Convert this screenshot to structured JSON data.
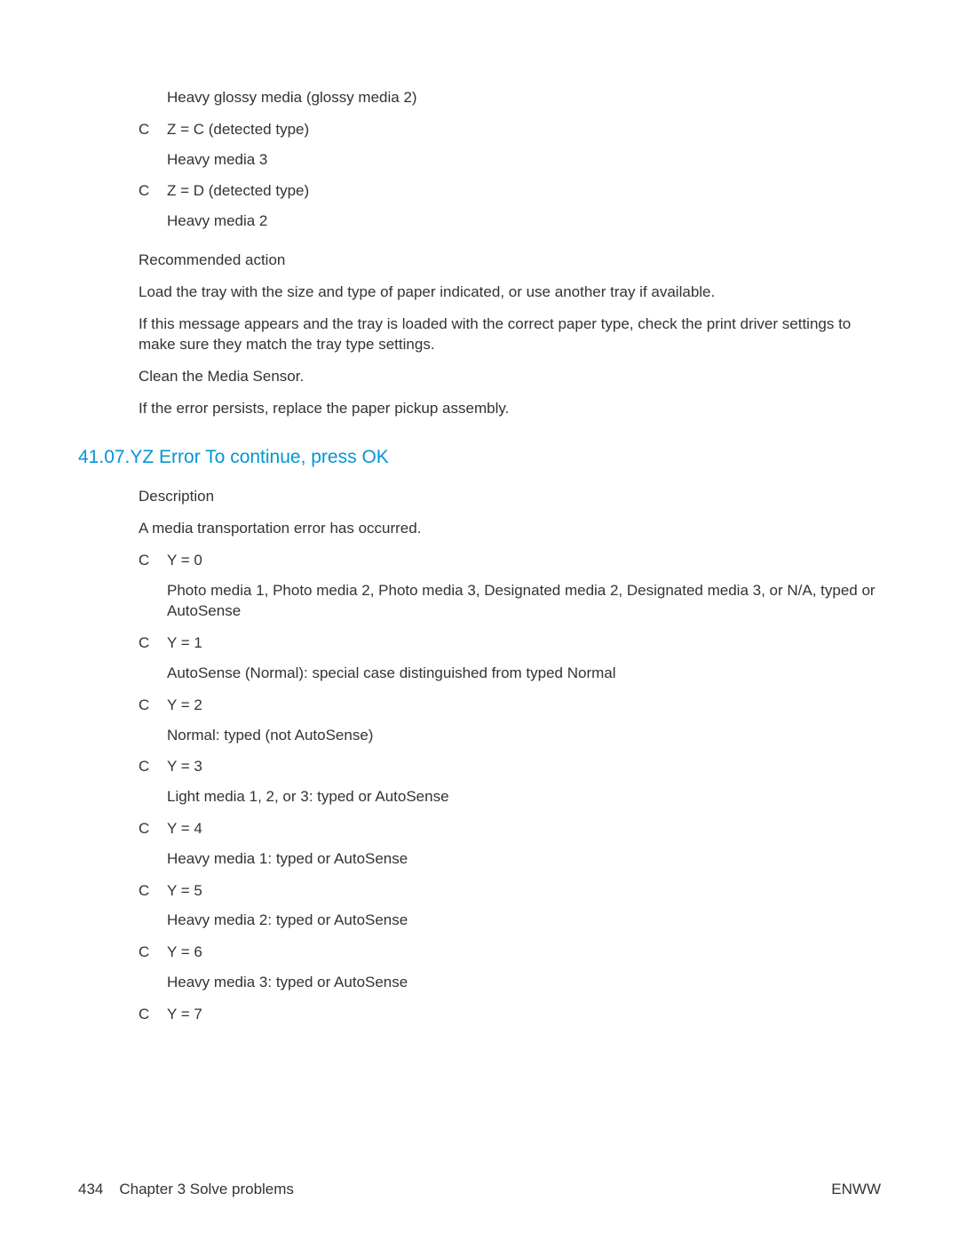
{
  "section1": {
    "leading_nested": "Heavy glossy media (glossy media 2)",
    "items": [
      {
        "code": "Z = C (detected type)",
        "detail": "Heavy media 3"
      },
      {
        "code": "Z = D (detected type)",
        "detail": "Heavy media 2"
      }
    ],
    "recommended_label": "Recommended action",
    "recommended_paras": [
      "Load the tray with the size and type of paper indicated, or use another tray if available.",
      "If this message appears and the tray is loaded with the correct paper type, check the print driver settings to make sure they match the tray type settings.",
      "Clean the Media Sensor.",
      "If the error persists, replace the paper pickup assembly."
    ]
  },
  "section2": {
    "heading": "41.07.YZ Error To continue, press OK",
    "description_label": "Description",
    "description_text": "A media transportation error has occurred.",
    "items": [
      {
        "code": "Y = 0",
        "detail": "Photo media 1, Photo media 2, Photo media 3, Designated media 2, Designated media 3, or N/A, typed or AutoSense"
      },
      {
        "code": "Y = 1",
        "detail": "AutoSense (Normal): special case distinguished from typed Normal"
      },
      {
        "code": "Y = 2",
        "detail": "Normal: typed (not AutoSense)"
      },
      {
        "code": "Y = 3",
        "detail": "Light media 1, 2, or 3: typed or AutoSense"
      },
      {
        "code": "Y = 4",
        "detail": "Heavy media 1: typed or AutoSense"
      },
      {
        "code": "Y = 5",
        "detail": "Heavy media 2: typed or AutoSense"
      },
      {
        "code": "Y = 6",
        "detail": "Heavy media 3: typed or AutoSense"
      },
      {
        "code": "Y = 7",
        "detail": ""
      }
    ],
    "bullet_marker": "C"
  },
  "footer": {
    "page_number": "434",
    "chapter": "Chapter 3   Solve problems",
    "right": "ENWW"
  }
}
